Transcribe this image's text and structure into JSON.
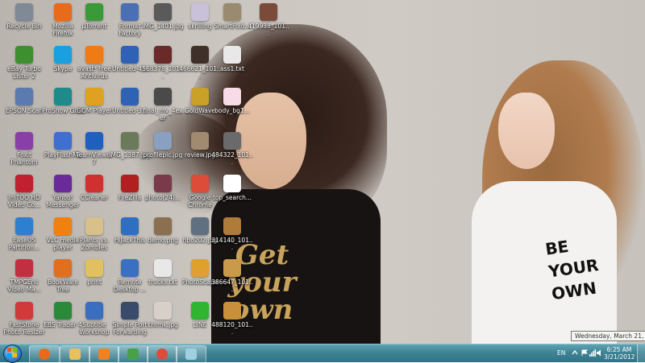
{
  "desktop_icons": [
    {
      "label": "Recycle Bin",
      "icon": "recycle-bin-icon",
      "color": "#7f8a96"
    },
    {
      "label": "Mozilla Firefox",
      "icon": "firefox-icon",
      "color": "#e76b1a"
    },
    {
      "label": "µTorrent",
      "icon": "utorrent-icon",
      "color": "#3a9a3a"
    },
    {
      "label": "Format Factory",
      "icon": "format-factory-icon",
      "color": "#4a6fb5"
    },
    {
      "label": "IMG_1401.jpg",
      "icon": "image-file-icon",
      "color": "#5a5a5a"
    },
    {
      "label": "skrilling",
      "icon": "file-icon",
      "color": "#c9c1d9"
    },
    {
      "label": "SmartFold...",
      "icon": "folder-icon",
      "color": "#9a8b70"
    },
    {
      "label": "419938_101...",
      "icon": "image-file-icon",
      "color": "#7a4a3a"
    },
    {
      "label": "eBay Turbo Lister 2",
      "icon": "ebay-icon",
      "color": "#3d8f2f"
    },
    {
      "label": "Skype",
      "icon": "skype-icon",
      "color": "#1aa0e0"
    },
    {
      "label": "avast! Free Antivirus",
      "icon": "avast-icon",
      "color": "#f07a13"
    },
    {
      "label": "Untitled-4...",
      "icon": "photoshop-icon",
      "color": "#2f62b5"
    },
    {
      "label": "568378_101...",
      "icon": "image-file-icon",
      "color": "#6b2a2a"
    },
    {
      "label": "466621_101...",
      "icon": "image-file-icon",
      "color": "#40302a"
    },
    {
      "label": "ass1.txt",
      "icon": "text-file-icon",
      "color": "#e8e8e8"
    },
    {
      "label": "EPSON Scan",
      "icon": "epson-icon",
      "color": "#5a7ab0"
    },
    {
      "label": "ProShow Gold",
      "icon": "proshow-icon",
      "color": "#1f8a8a"
    },
    {
      "label": "GOM Player",
      "icon": "gom-player-icon",
      "color": "#e0a020"
    },
    {
      "label": "Untitled-3...",
      "icon": "photoshop-icon",
      "color": "#2f62b5"
    },
    {
      "label": "final_mv_4ever",
      "icon": "image-file-icon",
      "color": "#4a4a4a"
    },
    {
      "label": "GoldWave",
      "icon": "goldwave-icon",
      "color": "#c9a028"
    },
    {
      "label": "body_bg1...",
      "icon": "image-file-icon",
      "color": "#f7dbe6"
    },
    {
      "label": "Foxit Phantom",
      "icon": "foxit-icon",
      "color": "#8a3fa8"
    },
    {
      "label": "PlayFlashMe",
      "icon": "playflash-icon",
      "color": "#3f6fd0"
    },
    {
      "label": "TeamViewer 7",
      "icon": "teamviewer-icon",
      "color": "#1f5fbf"
    },
    {
      "label": "IMG_1387.jpg",
      "icon": "image-file-icon",
      "color": "#6a7a5a"
    },
    {
      "label": "profilepic.jpg",
      "icon": "image-file-icon",
      "color": "#8aa0c0"
    },
    {
      "label": "review.jpg",
      "icon": "image-file-icon",
      "color": "#a08a70"
    },
    {
      "label": "484322_101...",
      "icon": "image-file-icon",
      "color": "#6a6a6a"
    },
    {
      "label": "ImTOO HD Video Co...",
      "icon": "imtoo-icon",
      "color": "#c02030"
    },
    {
      "label": "Yahoo! Messenger",
      "icon": "yahoo-icon",
      "color": "#6a2a9a"
    },
    {
      "label": "CCleaner",
      "icon": "ccleaner-icon",
      "color": "#d03030"
    },
    {
      "label": "FileZilla",
      "icon": "filezilla-icon",
      "color": "#b02020"
    },
    {
      "label": "photo(24)...",
      "icon": "image-file-icon",
      "color": "#7a3a4a"
    },
    {
      "label": "Google Chrome",
      "icon": "chrome-icon",
      "color": "#dd4b39"
    },
    {
      "label": "top_search...",
      "icon": "image-file-icon",
      "color": "#ffffff"
    },
    {
      "label": "EaseUS Partition...",
      "icon": "easeus-icon",
      "color": "#2f7fd0"
    },
    {
      "label": "VLC media player",
      "icon": "vlc-icon",
      "color": "#f08010"
    },
    {
      "label": "Plants vs. Zombies",
      "icon": "pvz-icon",
      "color": "#d8c08a"
    },
    {
      "label": "HiJackThis",
      "icon": "hijackthis-icon",
      "color": "#2f6fbf"
    },
    {
      "label": "demo.png",
      "icon": "image-file-icon",
      "color": "#8a7050"
    },
    {
      "label": "hbo202.jpg",
      "icon": "image-file-icon",
      "color": "#607080"
    },
    {
      "label": "314140_101...",
      "icon": "image-file-icon",
      "color": "#b07a3a"
    },
    {
      "label": "TMPGEnc Video Ma...",
      "icon": "tmpgenc-icon",
      "color": "#c03040"
    },
    {
      "label": "BookWare Tree",
      "icon": "bookware-icon",
      "color": "#e07020"
    },
    {
      "label": "print",
      "icon": "folder-icon",
      "color": "#e0c060"
    },
    {
      "label": "Remote Desktop ...",
      "icon": "remote-desktop-icon",
      "color": "#3a70c0"
    },
    {
      "label": "trucks.txt",
      "icon": "text-file-icon",
      "color": "#e8e8e8"
    },
    {
      "label": "PhotoScape",
      "icon": "photoscape-icon",
      "color": "#e0a030"
    },
    {
      "label": "386647_101...",
      "icon": "image-file-icon",
      "color": "#c89a4a"
    },
    {
      "label": "FastStone Photo Resizer",
      "icon": "faststone-icon",
      "color": "#d03a3a"
    },
    {
      "label": "EBS Trader 4",
      "icon": "ebs-icon",
      "color": "#2a8a3a"
    },
    {
      "label": "Subtitle Workshop",
      "icon": "subtitle-icon",
      "color": "#3a6fc0"
    },
    {
      "label": "Simple Port Forwarding",
      "icon": "simple-port-icon",
      "color": "#3a4a6a"
    },
    {
      "label": "chrmk.jpg",
      "icon": "image-file-icon",
      "color": "#d8d0c8"
    },
    {
      "label": "488120_101...",
      "icon": "image-file-icon",
      "color": "#c8903a"
    },
    {
      "label": "LINE",
      "icon": "line-icon",
      "color": "#2fb52f"
    }
  ],
  "taskbar": {
    "pinned": [
      {
        "name": "firefox-taskbar-button",
        "icon": "firefox-icon",
        "color": "#e76b1a"
      },
      {
        "name": "explorer-taskbar-button",
        "icon": "folder-icon",
        "color": "#e8c060"
      },
      {
        "name": "media-player-taskbar-button",
        "icon": "media-player-icon",
        "color": "#f08020"
      },
      {
        "name": "network-taskbar-button",
        "icon": "network-icon",
        "color": "#4aa04a"
      },
      {
        "name": "chrome-taskbar-button",
        "icon": "chrome-icon",
        "color": "#dd4b39"
      },
      {
        "name": "window-taskbar-button",
        "icon": "window-icon",
        "color": "#9fd0e0"
      }
    ],
    "language": "EN",
    "time": "6:25 AM",
    "date": "3/21/2012"
  },
  "tooltip": "Wednesday, March 21, 2012",
  "wallpaper": {
    "left_shirt_text": "Get your own",
    "right_shirt_text": "BE YOUR OWN"
  }
}
